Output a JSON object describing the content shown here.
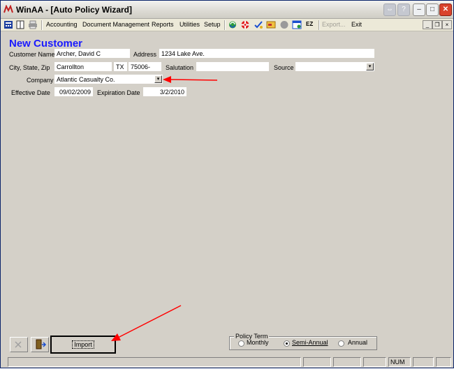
{
  "window": {
    "title": "WinAA - [Auto Policy Wizard]"
  },
  "menu": {
    "items": [
      "Accounting",
      "Document Management",
      "Reports",
      "Utilities",
      "Setup"
    ],
    "ez_label": "EZ",
    "export_label": "Export...",
    "exit_label": "Exit"
  },
  "form": {
    "title": "New Customer",
    "customer_name_label": "Customer Name",
    "customer_name": "Archer, David C",
    "address_label": "Address",
    "address": "1234 Lake Ave.",
    "city_state_zip_label": "City, State, Zip",
    "city": "Carrollton",
    "state": "TX",
    "zip": "75006-",
    "salutation_label": "Salutation",
    "salutation": "",
    "source_label": "Source",
    "source": "",
    "company_label": "Company",
    "company": "Atlantic Casualty Co.",
    "effective_date_label": "Effective Date",
    "effective_date": "09/02/2009",
    "expiration_date_label": "Expiration Date",
    "expiration_date": "3/2/2010"
  },
  "bottom": {
    "import_label": "Import",
    "policy_term_label": "Policy Term",
    "policy_term_options": [
      "Monthly",
      "Semi-Annual",
      "Annual"
    ],
    "policy_term_selected": "Semi-Annual"
  },
  "status": {
    "num": "NUM"
  },
  "colors": {
    "title_blue": "#1a1aff",
    "annotation_arrow": "#ff0000"
  }
}
